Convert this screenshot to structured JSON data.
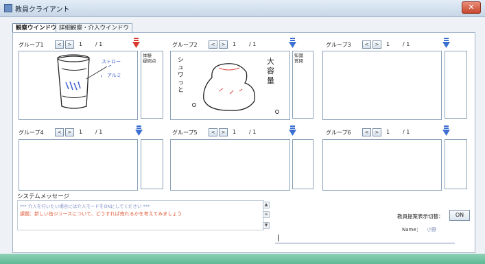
{
  "window": {
    "title": "教員クライアント",
    "close_label": "✕"
  },
  "tabs": [
    {
      "label": "観察ウインドウ",
      "active": true
    },
    {
      "label": "詳細観察・介入ウインドウ",
      "active": false
    }
  ],
  "nav": {
    "prev": "<",
    "next": ">"
  },
  "groups": [
    {
      "label": "グループ1",
      "page": "1",
      "total": "/ 1",
      "flag_color": "#d93a2e",
      "notes": [
        "体験",
        "疑問点"
      ]
    },
    {
      "label": "グループ2",
      "page": "1",
      "total": "/ 1",
      "flag_color": "#3b6fd1",
      "notes": [
        "知識",
        "質問"
      ]
    },
    {
      "label": "グループ3",
      "page": "1",
      "total": "/ 1",
      "flag_color": "#3b6fd1",
      "notes": []
    },
    {
      "label": "グループ4",
      "page": "1",
      "total": "/ 1",
      "flag_color": "#3b6fd1",
      "notes": []
    },
    {
      "label": "グループ5",
      "page": "1",
      "total": "/ 1",
      "flag_color": "#3b6fd1",
      "notes": []
    },
    {
      "label": "グループ6",
      "page": "1",
      "total": "/ 1",
      "flag_color": "#3b6fd1",
      "notes": []
    }
  ],
  "sketches": {
    "g1": {
      "annotation1": "ストロー",
      "annotation2": "アルミ"
    },
    "g2": {
      "left_text": "シュワっと",
      "right_text": "大容量"
    }
  },
  "system_messages": {
    "label": "システムメッセージ",
    "lines": [
      "*** 介入を行いたい場合には介入モードをONにしてください ***",
      "課題：新しい缶ジュースについて、どうすれば売れるかを考えてみましょう"
    ]
  },
  "controls": {
    "toggle_label": "教員提案表示切替：",
    "toggle_value": "ON",
    "name_label": "Name：",
    "name_value": "小野"
  },
  "colors": {
    "accent": "#3b6fd1",
    "alert": "#d93a2e",
    "status_bar": "#5fb995"
  }
}
